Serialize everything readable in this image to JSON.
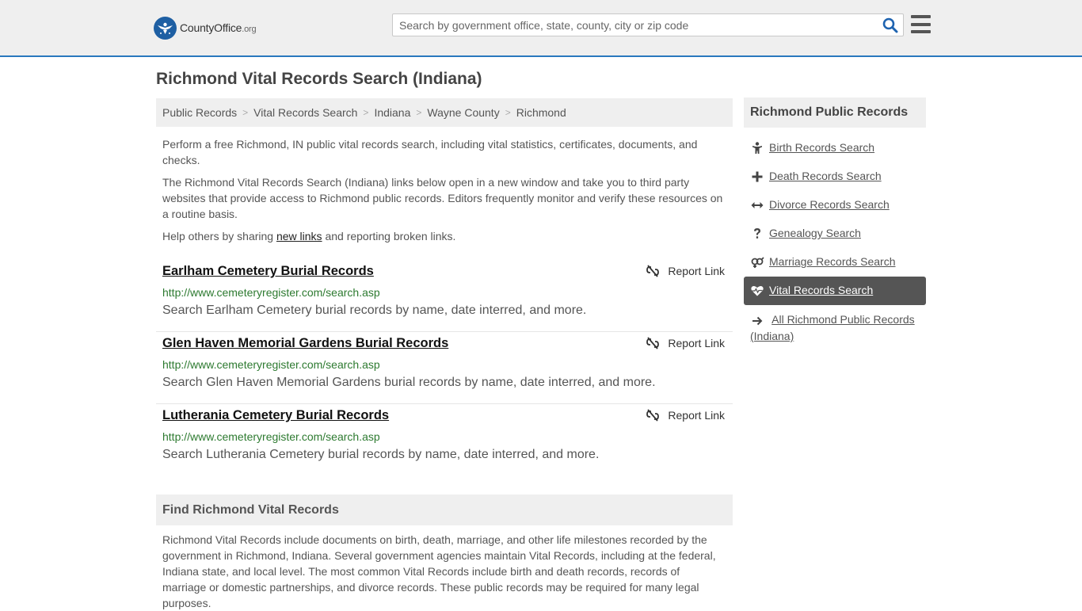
{
  "header": {
    "logo_main": "CountyOffice",
    "logo_suffix": ".org",
    "search_placeholder": "Search by government office, state, county, city or zip code"
  },
  "page": {
    "title": "Richmond Vital Records Search (Indiana)"
  },
  "breadcrumb": [
    "Public Records",
    "Vital Records Search",
    "Indiana",
    "Wayne County",
    "Richmond"
  ],
  "intro": {
    "p1": "Perform a free Richmond, IN public vital records search, including vital statistics, certificates, documents, and checks.",
    "p2": "The Richmond Vital Records Search (Indiana) links below open in a new window and take you to third party websites that provide access to Richmond public records. Editors frequently monitor and verify these resources on a routine basis.",
    "p3_before": "Help others by sharing ",
    "p3_link": "new links",
    "p3_after": " and reporting broken links."
  },
  "results": [
    {
      "title": "Earlham Cemetery Burial Records",
      "url": "http://www.cemeteryregister.com/search.asp",
      "desc": "Search Earlham Cemetery burial records by name, date interred, and more.",
      "report": "Report Link"
    },
    {
      "title": "Glen Haven Memorial Gardens Burial Records",
      "url": "http://www.cemeteryregister.com/search.asp",
      "desc": "Search Glen Haven Memorial Gardens burial records by name, date interred, and more.",
      "report": "Report Link"
    },
    {
      "title": "Lutherania Cemetery Burial Records",
      "url": "http://www.cemeteryregister.com/search.asp",
      "desc": "Search Lutherania Cemetery burial records by name, date interred, and more.",
      "report": "Report Link"
    }
  ],
  "find": {
    "title": "Find Richmond Vital Records",
    "body": "Richmond Vital Records include documents on birth, death, marriage, and other life milestones recorded by the government in Richmond, Indiana. Several government agencies maintain Vital Records, including at the federal, Indiana state, and local level. The most common Vital Records include birth and death records, records of marriage or domestic partnerships, and divorce records. These public records may be required for many legal purposes."
  },
  "sidebar": {
    "title": "Richmond Public Records",
    "items": [
      {
        "label": "Birth Records Search",
        "icon": "child-icon"
      },
      {
        "label": "Death Records Search",
        "icon": "cross-icon"
      },
      {
        "label": "Divorce Records Search",
        "icon": "arrows-horizontal-icon"
      },
      {
        "label": "Genealogy Search",
        "icon": "question-icon"
      },
      {
        "label": "Marriage Records Search",
        "icon": "gender-icon"
      },
      {
        "label": "Vital Records Search",
        "icon": "heartbeat-icon"
      },
      {
        "label": "All Richmond Public Records (Indiana)",
        "icon": "arrow-right-icon"
      }
    ]
  }
}
